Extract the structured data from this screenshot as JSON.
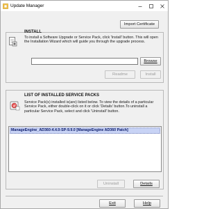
{
  "window": {
    "title": "Update Manager",
    "icon": "update-manager-icon"
  },
  "toolbar": {
    "import_certificate_label": "Import Certificate"
  },
  "install": {
    "section_title": "INSTALL",
    "description": "To install a Software Upgrade or Service Pack, click 'Install' button. This will open the Installation Wizard which will guide you through the upgrade process.",
    "path_value": "",
    "browse_label": "Browse",
    "readme_label": "Readme",
    "install_label": "Install"
  },
  "installed": {
    "section_title": "LIST OF INSTALLED SERVICE PACKS",
    "description": "Service Pack(s) installed is(are) listed below. To view the details of a particular Service Pack, either double-click on it or click 'Details' button.To uninstall a particular Service Pack, select and click 'Uninstall' button.",
    "items": [
      "ManageEngine_AD360-4.4.0-SP-9.9.0 [ManageEngine AD360 Patch]"
    ],
    "uninstall_label": "Uninstall",
    "details_label": "Details"
  },
  "footer": {
    "exit_label": "Exit",
    "help_label": "Help"
  }
}
